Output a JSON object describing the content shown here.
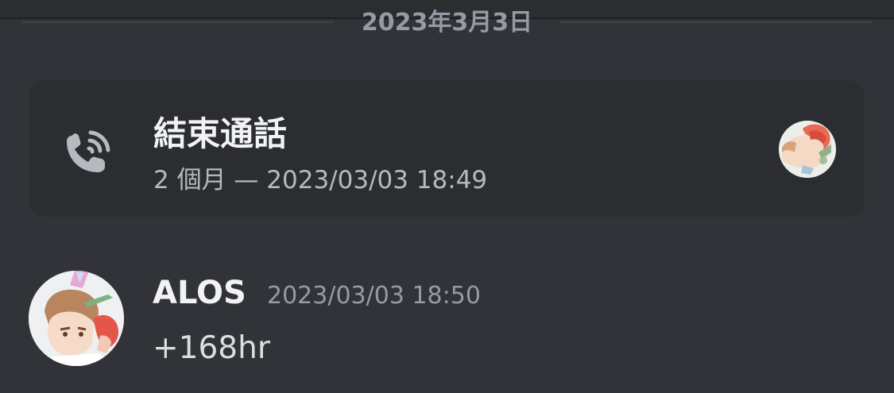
{
  "date_divider": {
    "text": "2023年3月3日"
  },
  "call_event": {
    "title": "結束通話",
    "subtitle": "2 個月 — 2023/03/03 18:49",
    "icon": "phone-call-icon",
    "participant_avatar": "user-avatar"
  },
  "message": {
    "author": "ALOS",
    "timestamp": "2023/03/03 18:50",
    "content": "+168hr",
    "avatar": "user-avatar"
  },
  "colors": {
    "background": "#313338",
    "card": "#2b2d31",
    "text_primary": "#f2f3f5",
    "text_muted": "#949ba4"
  }
}
